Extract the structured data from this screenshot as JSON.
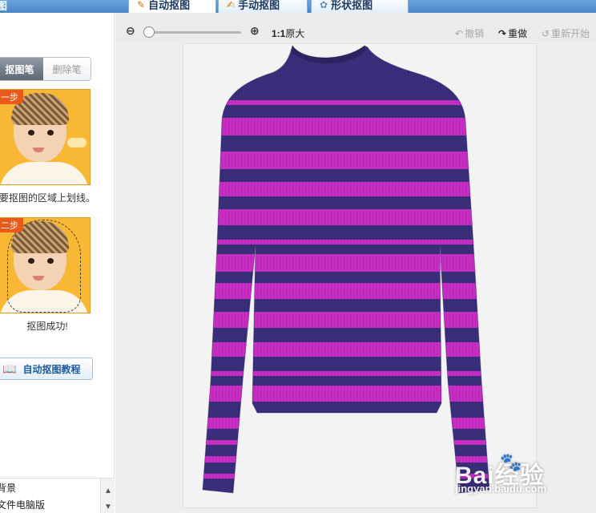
{
  "header": {
    "left_title": "图",
    "tabs": [
      {
        "label": "自动抠图",
        "icon": "brush-icon",
        "active": true
      },
      {
        "label": "手动抠图",
        "icon": "hand-brush-icon",
        "active": false
      },
      {
        "label": "形状抠图",
        "icon": "shape-icon",
        "active": false
      }
    ]
  },
  "sidebar": {
    "pen_tabs": [
      {
        "label": "抠图笔",
        "active": true
      },
      {
        "label": "删除笔",
        "active": false
      }
    ],
    "steps": [
      {
        "tag": "一步",
        "caption": "要抠图的区域上划线。"
      },
      {
        "tag": "二步",
        "caption": "抠图成功!"
      }
    ],
    "tutorial_button": "自动抠图教程",
    "bottom_list": [
      "背景",
      "文件电脑版"
    ]
  },
  "toolbar": {
    "zoom_ratio": "1:1",
    "original_size": "原大",
    "zoom_level": 0.0,
    "undo": "撤销",
    "redo": "重做",
    "restart": "重新开始"
  },
  "canvas": {
    "watermark_logo": "Bai经验",
    "watermark_url": "jingyan.baidu.com"
  },
  "colors": {
    "sweater_purple": "#3a2f7a",
    "sweater_magenta": "#c72fc2",
    "tab_bar": "#5a96d2",
    "step_card": "#f8b833"
  }
}
